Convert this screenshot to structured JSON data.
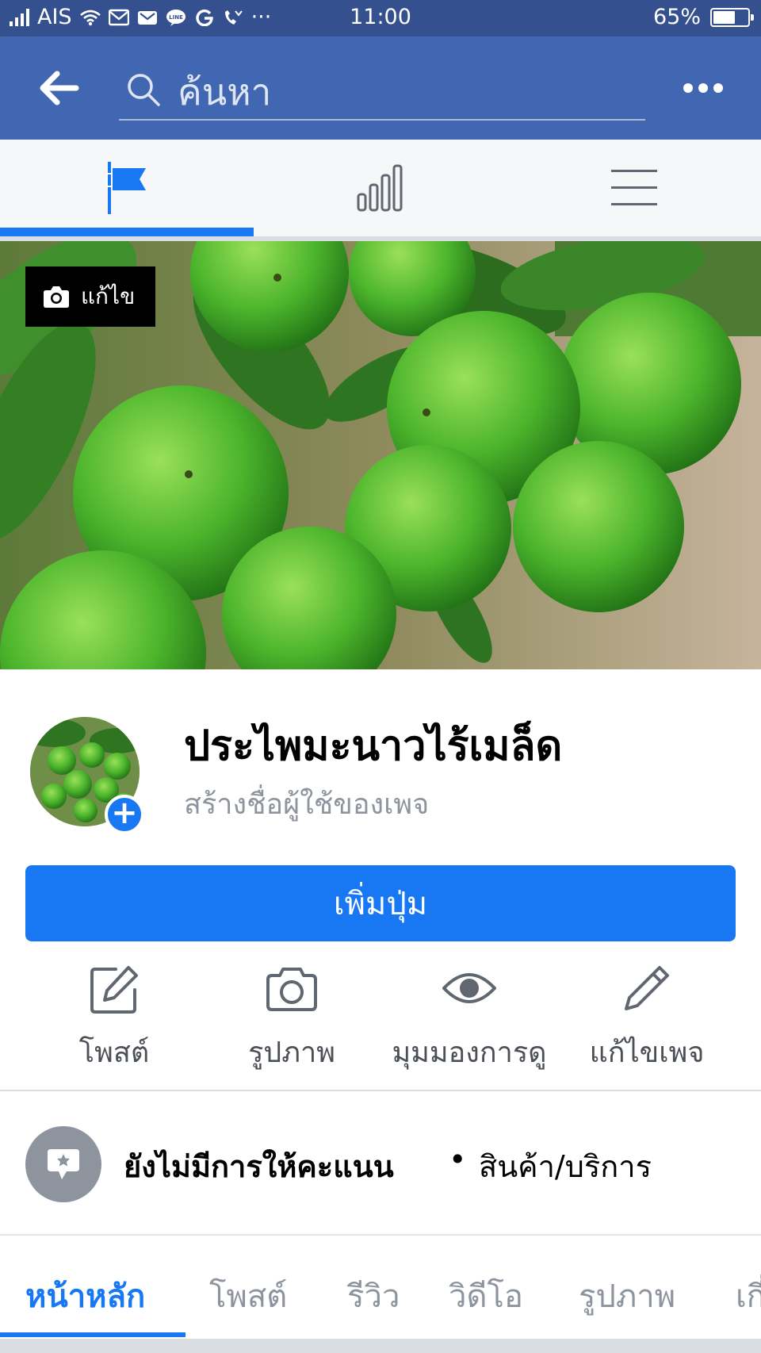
{
  "status_bar": {
    "carrier": "AIS",
    "time": "11:00",
    "battery_percent": "65%",
    "battery_level": 0.65,
    "more_indicator": "···"
  },
  "header": {
    "search_placeholder": "ค้นหา",
    "back_icon": "arrow-left-icon",
    "more_icon": "more-dots-icon"
  },
  "top_nav": {
    "items": [
      "page-flag-icon",
      "insights-bar-chart-icon",
      "hamburger-menu-icon"
    ],
    "active_index": 0
  },
  "cover": {
    "edit_label": "แก้ไข"
  },
  "profile": {
    "page_name": "ประไพมะนาวไร้เมล็ด",
    "create_username": "สร้างชื่อผู้ใช้ของเพจ"
  },
  "primary_button": {
    "label": "เพิ่มปุ่ม"
  },
  "actions": [
    {
      "label": "โพสต์",
      "icon": "compose-icon"
    },
    {
      "label": "รูปภาพ",
      "icon": "camera-icon"
    },
    {
      "label": "มุมมองการดู",
      "icon": "eye-icon"
    },
    {
      "label": "แก้ไขเพจ",
      "icon": "pencil-icon"
    }
  ],
  "rating": {
    "text": "ยังไม่มีการให้คะแนน",
    "separator": "•",
    "category": "สินค้า/บริการ"
  },
  "tabs": [
    "หน้าหลัก",
    "โพสต์",
    "รีวิว",
    "วิดีโอ",
    "รูปภาพ",
    "เกี่ยวกับ"
  ],
  "colors": {
    "brand_blue": "#4267b2",
    "action_blue": "#1877f2",
    "status_bar": "#34508e"
  }
}
